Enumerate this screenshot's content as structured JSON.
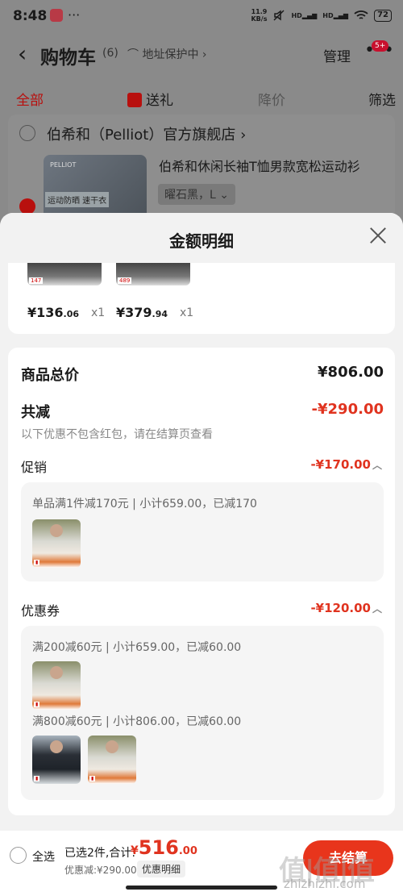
{
  "status": {
    "time": "8:48",
    "more": "···",
    "speed_top": "11.9",
    "speed_bottom": "KB/s",
    "hd1": "HD",
    "hd2": "HD",
    "battery": "72"
  },
  "header": {
    "back": "‹",
    "title": "购物车",
    "count": "(6)",
    "address": "⌒ 地址保护中 ›",
    "manage": "管理",
    "more": "•••",
    "badge": "5+"
  },
  "tabs": [
    {
      "label": "全部"
    },
    {
      "label": "送礼"
    },
    {
      "label": "降价"
    },
    {
      "label": "筛选"
    }
  ],
  "store": {
    "name": "伯希和（Pelliot）官方旗舰店 ›",
    "product_title": "伯希和休闲长袖T恤男款宽松运动衫",
    "sku": "曜石黑，L ⌄",
    "image_brand": "PELLIOT",
    "image_tag": "运动防晒\n速干衣"
  },
  "sheet": {
    "title": "金额明细",
    "items": [
      {
        "price_int": "¥136",
        "price_dec": ".06",
        "qty": "x1",
        "thumb_label": "147"
      },
      {
        "price_int": "¥379",
        "price_dec": ".94",
        "qty": "x1",
        "thumb_label": "489"
      }
    ],
    "total_label": "商品总价",
    "total_amount": "¥806.00",
    "reduce_label": "共减",
    "reduce_amount": "-¥290.00",
    "reduce_note": "以下优惠不包含红包，请在结算页查看",
    "promo": {
      "label": "促销",
      "amount": "-¥170.00",
      "rules": [
        {
          "text": "单品满1件减170元 | 小计659.00，已减170"
        }
      ]
    },
    "coupon": {
      "label": "优惠券",
      "amount": "-¥120.00",
      "rules": [
        {
          "text": "满200减60元 | 小计659.00，已减60.00"
        },
        {
          "text": "满800减60元 | 小计806.00，已减60.00"
        }
      ]
    }
  },
  "bottom": {
    "select_all": "全选",
    "selected": "已选2件,合计:",
    "total_cur": "¥",
    "total_int": "516",
    "total_dec": ".00",
    "discount": "优惠减:¥290.00",
    "detail_chip": "优惠明细",
    "checkout": "去结算",
    "watermark": "值|值|值",
    "watermark_url": "zhizhizhi.com"
  },
  "colors": {
    "accent": "#e0331f",
    "brand_red": "#b8100e"
  }
}
